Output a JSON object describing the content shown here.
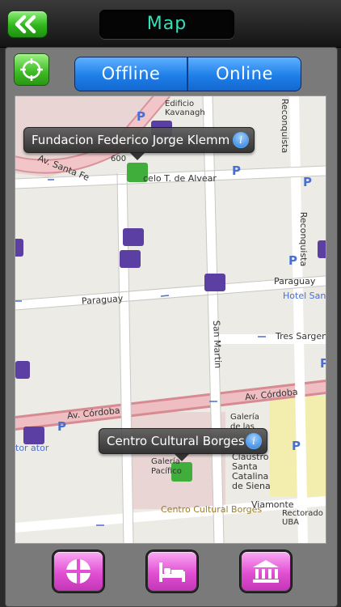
{
  "header": {
    "title": "Map",
    "back_icon": "double-chevron-left-icon"
  },
  "mode_switch": {
    "offline_label": "Offline",
    "online_label": "Online",
    "selected": "Offline"
  },
  "map": {
    "streets": {
      "av_santa_fe": "Av. Santa Fe",
      "marcelo_alvear": "celo T. de Alvear",
      "paraguay_left": "Paraguay",
      "paraguay_right": "Paraguay",
      "san_martin": "San Martin",
      "tres_sargentos": "Tres Sargent",
      "av_cordoba_left": "Av. Córdoba",
      "av_cordoba_right": "Av. Córdoba",
      "viamonte": "Viamonte",
      "reconquista_top": "Reconquista",
      "reconquista_mid": "Reconquista"
    },
    "places": {
      "edificio_kavanagh": "Edificio Kavanagh",
      "number_600": "600",
      "hotel_san": "Hotel San A",
      "galeria_de_las": "Galería de las",
      "galeria_pac": "Galería Pacífico",
      "claustro": "Claustro Santa Catalina de Siena",
      "centro_label": "Centro Cultural Borges",
      "rectorado": "Rectorado UBA",
      "tor_ator": "tor ator"
    },
    "callouts": [
      {
        "title": "Fundacion Federico Jorge Klemm"
      },
      {
        "title": "Centro Cultural Borges"
      }
    ]
  },
  "bottom_nav": [
    {
      "name": "attractions",
      "icon": "crosshair-circle-icon"
    },
    {
      "name": "hotels",
      "icon": "bed-icon"
    },
    {
      "name": "museums",
      "icon": "museum-icon"
    }
  ]
}
